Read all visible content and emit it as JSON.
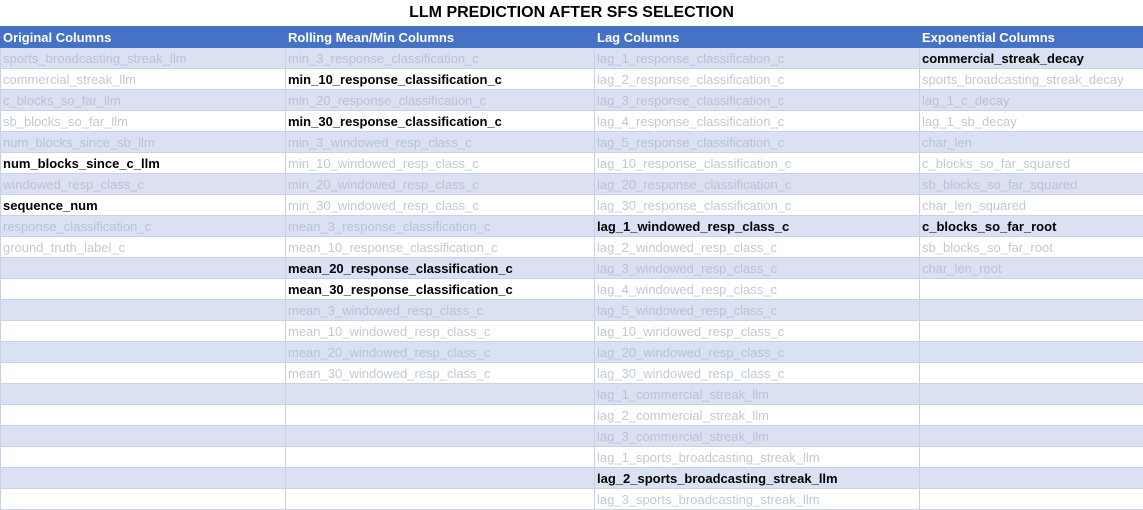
{
  "title": "LLM PREDICTION AFTER SFS SELECTION",
  "headers": [
    "Original Columns",
    "Rolling Mean/Min Columns",
    "Lag Columns",
    "Exponential Columns"
  ],
  "rows": [
    [
      {
        "t": "sports_broadcasting_streak_llm",
        "s": false
      },
      {
        "t": "min_3_response_classification_c",
        "s": false
      },
      {
        "t": "lag_1_response_classification_c",
        "s": false
      },
      {
        "t": "commercial_streak_decay",
        "s": true
      }
    ],
    [
      {
        "t": "commercial_streak_llm",
        "s": false
      },
      {
        "t": "min_10_response_classification_c",
        "s": true
      },
      {
        "t": "lag_2_response_classification_c",
        "s": false
      },
      {
        "t": "sports_broadcasting_streak_decay",
        "s": false
      }
    ],
    [
      {
        "t": "c_blocks_so_far_llm",
        "s": false
      },
      {
        "t": "min_20_response_classification_c",
        "s": false
      },
      {
        "t": "lag_3_response_classification_c",
        "s": false
      },
      {
        "t": "lag_1_c_decay",
        "s": false
      }
    ],
    [
      {
        "t": "sb_blocks_so_far_llm",
        "s": false
      },
      {
        "t": "min_30_response_classification_c",
        "s": true
      },
      {
        "t": "lag_4_response_classification_c",
        "s": false
      },
      {
        "t": "lag_1_sb_decay",
        "s": false
      }
    ],
    [
      {
        "t": "num_blocks_since_sb_llm",
        "s": false
      },
      {
        "t": "min_3_windowed_resp_class_c",
        "s": false
      },
      {
        "t": "lag_5_response_classification_c",
        "s": false
      },
      {
        "t": "char_len",
        "s": false
      }
    ],
    [
      {
        "t": "num_blocks_since_c_llm",
        "s": true
      },
      {
        "t": "min_10_windowed_resp_class_c",
        "s": false
      },
      {
        "t": "lag_10_response_classification_c",
        "s": false
      },
      {
        "t": "c_blocks_so_far_squared",
        "s": false
      }
    ],
    [
      {
        "t": "windowed_resp_class_c",
        "s": false
      },
      {
        "t": "min_20_windowed_resp_class_c",
        "s": false
      },
      {
        "t": "lag_20_response_classification_c",
        "s": false
      },
      {
        "t": "sb_blocks_so_far_squared",
        "s": false
      }
    ],
    [
      {
        "t": "sequence_num",
        "s": true
      },
      {
        "t": "min_30_windowed_resp_class_c",
        "s": false
      },
      {
        "t": "lag_30_response_classification_c",
        "s": false
      },
      {
        "t": "char_len_squared",
        "s": false
      }
    ],
    [
      {
        "t": "response_classification_c",
        "s": false
      },
      {
        "t": "mean_3_response_classification_c",
        "s": false
      },
      {
        "t": "lag_1_windowed_resp_class_c",
        "s": true
      },
      {
        "t": "c_blocks_so_far_root",
        "s": true
      }
    ],
    [
      {
        "t": "ground_truth_label_c",
        "s": false
      },
      {
        "t": "mean_10_response_classification_c",
        "s": false
      },
      {
        "t": "lag_2_windowed_resp_class_c",
        "s": false
      },
      {
        "t": "sb_blocks_so_far_root",
        "s": false
      }
    ],
    [
      {
        "t": "",
        "s": false
      },
      {
        "t": "mean_20_response_classification_c",
        "s": true
      },
      {
        "t": "lag_3_windowed_resp_class_c",
        "s": false
      },
      {
        "t": "char_len_root",
        "s": false
      }
    ],
    [
      {
        "t": "",
        "s": false
      },
      {
        "t": "mean_30_response_classification_c",
        "s": true
      },
      {
        "t": "lag_4_windowed_resp_class_c",
        "s": false
      },
      {
        "t": "",
        "s": false
      }
    ],
    [
      {
        "t": "",
        "s": false
      },
      {
        "t": "mean_3_windowed_resp_class_c",
        "s": false
      },
      {
        "t": "lag_5_windowed_resp_class_c",
        "s": false
      },
      {
        "t": "",
        "s": false
      }
    ],
    [
      {
        "t": "",
        "s": false
      },
      {
        "t": "mean_10_windowed_resp_class_c",
        "s": false
      },
      {
        "t": "lag_10_windowed_resp_class_c",
        "s": false
      },
      {
        "t": "",
        "s": false
      }
    ],
    [
      {
        "t": "",
        "s": false
      },
      {
        "t": "mean_20_windowed_resp_class_c",
        "s": false
      },
      {
        "t": "lag_20_windowed_resp_class_c",
        "s": false
      },
      {
        "t": "",
        "s": false
      }
    ],
    [
      {
        "t": "",
        "s": false
      },
      {
        "t": "mean_30_windowed_resp_class_c",
        "s": false
      },
      {
        "t": "lag_30_windowed_resp_class_c",
        "s": false
      },
      {
        "t": "",
        "s": false
      }
    ],
    [
      {
        "t": "",
        "s": false
      },
      {
        "t": "",
        "s": false
      },
      {
        "t": "lag_1_commercial_streak_llm",
        "s": false
      },
      {
        "t": "",
        "s": false
      }
    ],
    [
      {
        "t": "",
        "s": false
      },
      {
        "t": "",
        "s": false
      },
      {
        "t": "lag_2_commercial_streak_llm",
        "s": false
      },
      {
        "t": "",
        "s": false
      }
    ],
    [
      {
        "t": "",
        "s": false
      },
      {
        "t": "",
        "s": false
      },
      {
        "t": "lag_3_commercial_streak_llm",
        "s": false
      },
      {
        "t": "",
        "s": false
      }
    ],
    [
      {
        "t": "",
        "s": false
      },
      {
        "t": "",
        "s": false
      },
      {
        "t": "lag_1_sports_broadcasting_streak_llm",
        "s": false
      },
      {
        "t": "",
        "s": false
      }
    ],
    [
      {
        "t": "",
        "s": false
      },
      {
        "t": "",
        "s": false
      },
      {
        "t": "lag_2_sports_broadcasting_streak_llm",
        "s": true
      },
      {
        "t": "",
        "s": false
      }
    ],
    [
      {
        "t": "",
        "s": false
      },
      {
        "t": "",
        "s": false
      },
      {
        "t": "lag_3_sports_broadcasting_streak_llm",
        "s": false
      },
      {
        "t": "",
        "s": false
      }
    ]
  ]
}
